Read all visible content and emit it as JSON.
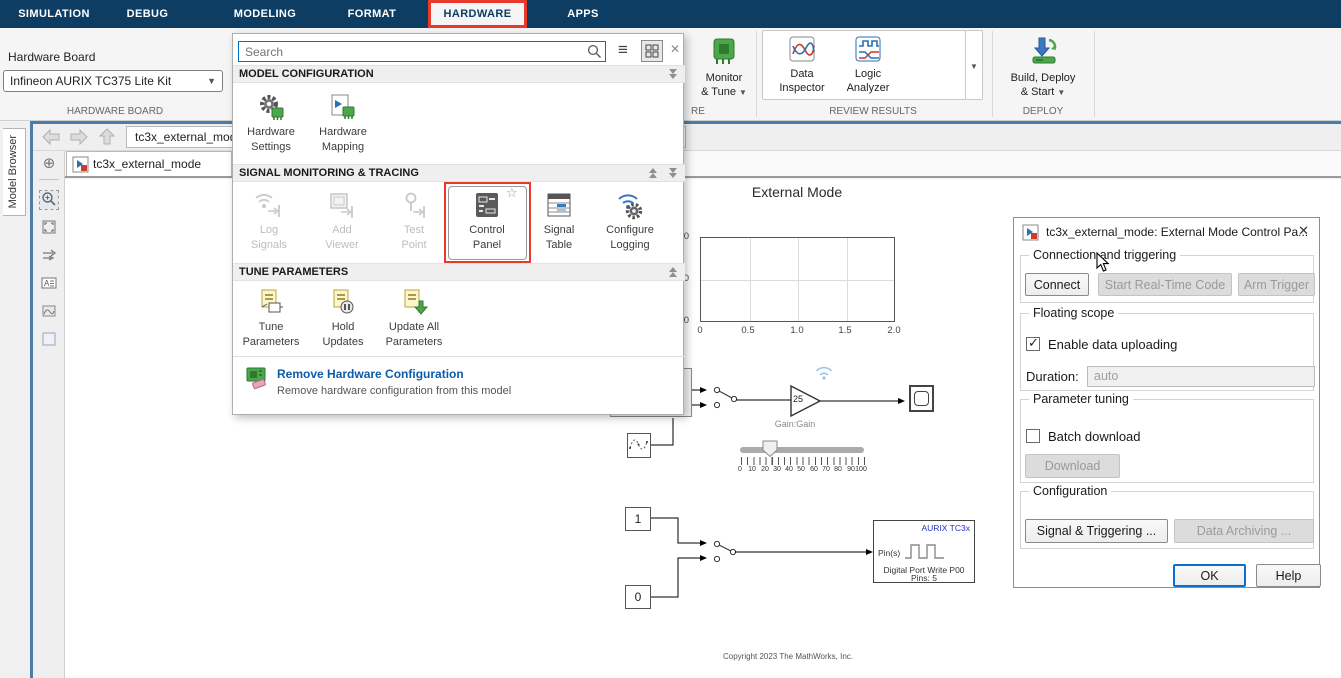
{
  "menu": {
    "tabs": [
      "SIMULATION",
      "DEBUG",
      "MODELING",
      "FORMAT",
      "HARDWARE",
      "APPS"
    ]
  },
  "ribbon": {
    "hardware_board_label": "Hardware Board",
    "hardware_board_value": "Infineon AURIX TC375 Lite Kit",
    "group_hardware_board": "HARDWARE BOARD",
    "monitor_tune_line1": "Monitor",
    "monitor_tune_line2": "& Tune",
    "group_fragment": "RE",
    "data_inspector_line1": "Data",
    "data_inspector_line2": "Inspector",
    "logic_analyzer_line1": "Logic",
    "logic_analyzer_line2": "Analyzer",
    "group_review_results": "REVIEW RESULTS",
    "build_deploy_line1": "Build, Deploy",
    "build_deploy_line2": "& Start",
    "group_deploy": "DEPLOY"
  },
  "popup": {
    "search_placeholder": "Search",
    "sections": [
      {
        "title": "MODEL CONFIGURATION"
      },
      {
        "title": "SIGNAL MONITORING & TRACING"
      },
      {
        "title": "TUNE PARAMETERS"
      }
    ],
    "items": {
      "hardware_settings": [
        "Hardware",
        "Settings"
      ],
      "hardware_mapping": [
        "Hardware",
        "Mapping"
      ],
      "log_signals": [
        "Log",
        "Signals"
      ],
      "add_viewer": [
        "Add",
        "Viewer"
      ],
      "test_point": [
        "Test",
        "Point"
      ],
      "control_panel": [
        "Control",
        "Panel"
      ],
      "signal_table": [
        "Signal",
        "Table"
      ],
      "configure_logging": [
        "Configure",
        "Logging"
      ],
      "tune_parameters": [
        "Tune",
        "Parameters"
      ],
      "hold_updates": [
        "Hold",
        "Updates"
      ],
      "update_all_parameters": [
        "Update All",
        "Parameters"
      ]
    },
    "footer_title": "Remove Hardware Configuration",
    "footer_subtitle": "Remove hardware configuration from this model"
  },
  "editor": {
    "model_browser": "Model Browser",
    "breadcrumb": "tc3x_external_mod",
    "tab_label": "tc3x_external_mode"
  },
  "canvas": {
    "title": "External Mode",
    "plot": {
      "x_ticks": [
        "0",
        "0.5",
        "1.0",
        "1.5",
        "2.0"
      ],
      "y_ticks_partial": [
        "0",
        "0",
        "0"
      ]
    },
    "gain_value": "25",
    "gain_label": "Gain:Gain",
    "slider_ticks": [
      "0",
      "10",
      "20",
      "30",
      "40",
      "50",
      "60",
      "70",
      "80",
      "90",
      "100"
    ],
    "const_top": "1",
    "const_bottom": "0",
    "aurix_title": "AURIX TC3x",
    "aurix_pin": "Pin(s)",
    "aurix_name": "Digital Port Write  P00",
    "aurix_pins": "Pins: 5",
    "copyright": "Copyright 2023 The MathWorks, Inc."
  },
  "dialog": {
    "title": "tc3x_external_mode: External Mode Control Pa...",
    "close": "✕",
    "groups": {
      "connection": "Connection and triggering",
      "floating": "Floating scope",
      "parameter": "Parameter tuning",
      "configuration": "Configuration"
    },
    "buttons": {
      "connect": "Connect",
      "start_rt": "Start Real-Time Code",
      "arm_trigger": "Arm Trigger",
      "download": "Download",
      "signal_triggering": "Signal & Triggering ...",
      "data_archiving": "Data Archiving ...",
      "ok": "OK",
      "help": "Help"
    },
    "enable_upload_label": "Enable data uploading",
    "duration_label": "Duration:",
    "duration_value": "auto",
    "batch_download_label": "Batch download"
  },
  "colors": {
    "tabbar_navy": "#0e3d64",
    "annotation_red": "#e8392b",
    "link_blue": "#0b5cab",
    "frame_blue": "#4a7ea8",
    "search_border_blue": "#0072c6"
  }
}
